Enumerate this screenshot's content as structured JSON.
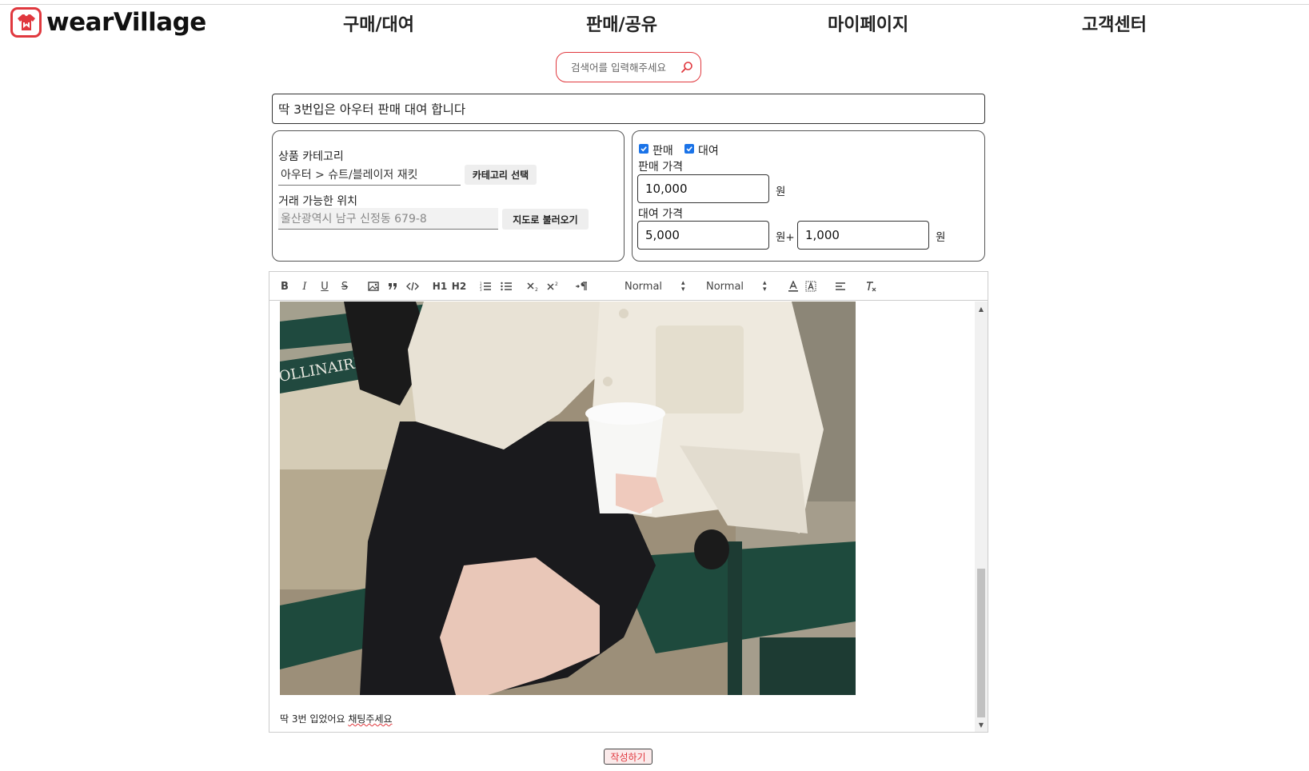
{
  "brand": {
    "name": "wearVillage",
    "color": "#e0383e",
    "logo_icon": "shirt-icon"
  },
  "nav": {
    "items": [
      "구매/대여",
      "판매/공유",
      "마이페이지",
      "고객센터"
    ]
  },
  "search": {
    "placeholder": "검색어를 입력해주세요",
    "icon": "search-icon"
  },
  "post": {
    "title": "딱 3번입은 아우터 판매 대여 합니다"
  },
  "category": {
    "label": "상품 카테고리",
    "value": "아우터 > 슈트/블레이저 재킷",
    "button": "카테고리 선택"
  },
  "location": {
    "label": "거래 가능한 위치",
    "placeholder": "울산광역시 남구 신정동 679-8",
    "button": "지도로 불러오기"
  },
  "trade": {
    "sale_label": "판매",
    "sale_checked": true,
    "rent_label": "대여",
    "rent_checked": true,
    "sale_price_label": "판매 가격",
    "sale_price": "10,000",
    "rent_price_label": "대여 가격",
    "rent_price": "5,000",
    "rent_extra": "1,000",
    "won": "원",
    "won_plus": "원+"
  },
  "editor": {
    "toolbar": {
      "bold": "B",
      "italic": "I",
      "underline": "U",
      "strike": "S",
      "h1": "H1",
      "h2": "H2",
      "font_select": "Normal",
      "size_select": "Normal"
    },
    "body_text_plain": "딱 3번 입었어요 ",
    "body_text_marked": "채팅주세요",
    "image_alt": "photo"
  },
  "submit": {
    "label": "작성하기"
  }
}
